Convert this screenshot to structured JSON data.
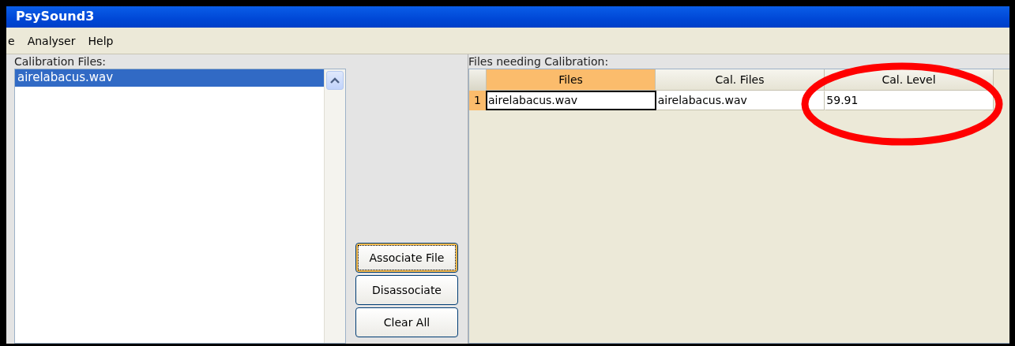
{
  "window": {
    "title": "PsySound3"
  },
  "menu": [
    "e",
    "Analyser",
    "Help"
  ],
  "calibration_panel": {
    "label": "Calibration Files:",
    "files": [
      {
        "name": "airelabacus.wav",
        "selected": true
      }
    ]
  },
  "buttons": [
    {
      "label": "Associate File",
      "focused": true
    },
    {
      "label": "Disassociate",
      "focused": false
    },
    {
      "label": "Clear All",
      "focused": false
    }
  ],
  "table_panel": {
    "label": "Files needing Calibration:",
    "columns": [
      {
        "label": "Files",
        "selected": true
      },
      {
        "label": "Cal. Files",
        "selected": false
      },
      {
        "label": "Cal. Level",
        "selected": false
      }
    ],
    "rows": [
      {
        "index": "1",
        "selected": true,
        "cells": [
          {
            "text": "airelabacus.wav",
            "focused": true
          },
          {
            "text": "airelabacus.wav",
            "focused": false
          },
          {
            "text": "59.91",
            "focused": false
          }
        ]
      }
    ]
  },
  "annotation": {
    "kind": "ellipse"
  }
}
